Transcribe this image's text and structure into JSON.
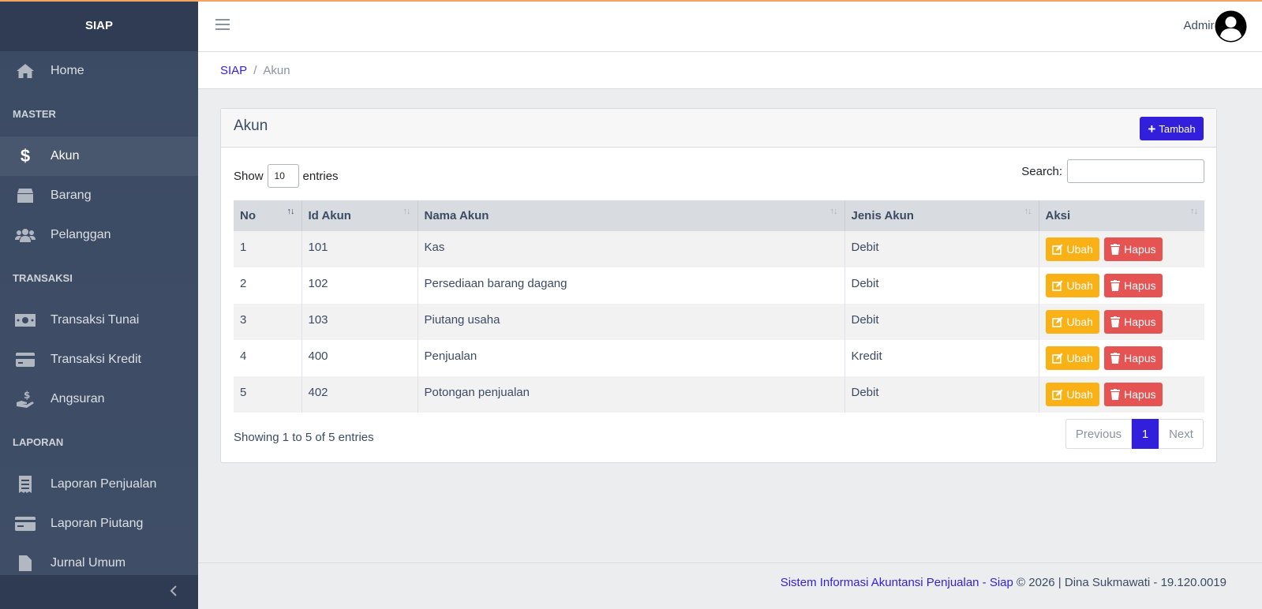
{
  "brand": "SIAP",
  "sidebar": {
    "home": "Home",
    "sections": [
      {
        "title": "MASTER",
        "items": [
          "Akun",
          "Barang",
          "Pelanggan"
        ]
      },
      {
        "title": "TRANSAKSI",
        "items": [
          "Transaksi Tunai",
          "Transaksi Kredit",
          "Angsuran"
        ]
      },
      {
        "title": "LAPORAN",
        "items": [
          "Laporan Penjualan",
          "Laporan Piutang",
          "Jurnal Umum"
        ]
      }
    ],
    "active": "Akun"
  },
  "header": {
    "user": "Admin"
  },
  "breadcrumb": {
    "root": "SIAP",
    "separator": "/",
    "current": "Akun"
  },
  "card": {
    "title": "Akun",
    "add_label": "Tambah",
    "show_label": "Show",
    "entries_label": "entries",
    "page_length": "10",
    "search_label": "Search:",
    "search_value": ""
  },
  "table": {
    "columns": [
      "No",
      "Id Akun",
      "Nama Akun",
      "Jenis Akun",
      "Aksi"
    ],
    "rows": [
      [
        "1",
        "101",
        "Kas",
        "Debit"
      ],
      [
        "2",
        "102",
        "Persediaan barang dagang",
        "Debit"
      ],
      [
        "3",
        "103",
        "Piutang usaha",
        "Debit"
      ],
      [
        "4",
        "400",
        "Penjualan",
        "Kredit"
      ],
      [
        "5",
        "402",
        "Potongan penjualan",
        "Debit"
      ]
    ],
    "edit_label": "Ubah",
    "delete_label": "Hapus"
  },
  "pagination": {
    "info": "Showing 1 to 5 of 5 entries",
    "previous": "Previous",
    "current": "1",
    "next": "Next"
  },
  "footer": {
    "link": "Sistem Informasi Akuntansi Penjualan - Siap",
    "text": " © 2026 | Dina Sukmawati - 19.120.0019"
  },
  "colors": {
    "primary": "#321fdb",
    "warning": "#f9b115",
    "danger": "#e55353",
    "sidebar": "#3c4b64"
  }
}
